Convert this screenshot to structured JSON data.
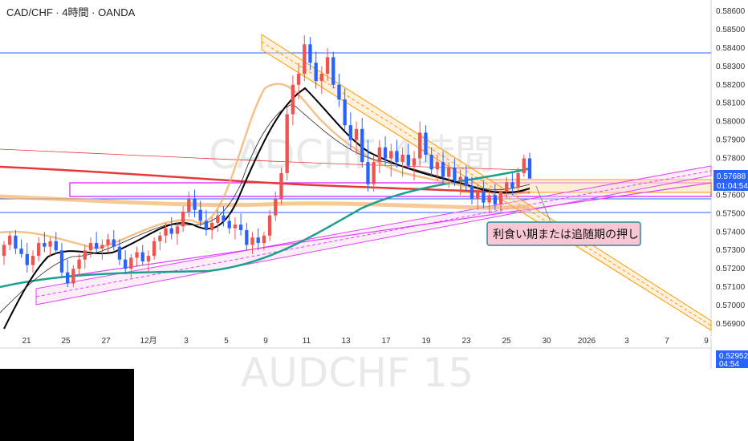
{
  "chart_data": {
    "type": "candlestick",
    "title": "CAD/CHF · 4時間 · OANDA",
    "watermark": "CADCHF 4時間",
    "watermark_bottom": "AUDCHF 15",
    "ylim": [
      0.5685,
      0.5862
    ],
    "y_ticks": [
      "0.58600",
      "0.58500",
      "0.58400",
      "0.58300",
      "0.58200",
      "0.58100",
      "0.58000",
      "0.57900",
      "0.57800",
      "0.57600",
      "0.57500",
      "0.57400",
      "0.57300",
      "0.57200",
      "0.57100",
      "0.57000",
      "0.56900"
    ],
    "x_ticks": [
      "21",
      "25",
      "27",
      "12月",
      "3",
      "5",
      "9",
      "11",
      "13",
      "17",
      "19",
      "23",
      "25",
      "30",
      "2026",
      "3",
      "7",
      "9"
    ],
    "price_label": {
      "value": "0.57688",
      "countdown": "01:04:54",
      "color": "#2962ff"
    },
    "second_price_label": {
      "value": "0.52952",
      "countdown": "04:54",
      "color": "#2962ff"
    },
    "annotation": "利食い期または追随期の押し",
    "colors": {
      "up": "#ef5350",
      "down": "#2962ff",
      "ma_fast": "#000000",
      "ma_teal": "#1e9e8c",
      "ma_red": "#e53935",
      "band_orange": "#f4b26b",
      "channel_orange": "#ff9800",
      "channel_pink": "#e040fb",
      "hline": "#2962ff",
      "annot_bg": "#f8c6d4",
      "annot_border": "#2a8a9a"
    },
    "candles": [
      [
        0.5727,
        0.5735,
        0.5722,
        0.5733
      ],
      [
        0.5733,
        0.574,
        0.573,
        0.5738
      ],
      [
        0.5738,
        0.5741,
        0.5728,
        0.5731
      ],
      [
        0.5731,
        0.5736,
        0.5726,
        0.5728
      ],
      [
        0.5728,
        0.5734,
        0.5718,
        0.5722
      ],
      [
        0.5722,
        0.573,
        0.5718,
        0.5727
      ],
      [
        0.5727,
        0.5737,
        0.5724,
        0.5734
      ],
      [
        0.5734,
        0.574,
        0.5729,
        0.5732
      ],
      [
        0.5732,
        0.5737,
        0.5727,
        0.5735
      ],
      [
        0.5735,
        0.574,
        0.5728,
        0.573
      ],
      [
        0.573,
        0.5734,
        0.5715,
        0.5718
      ],
      [
        0.5718,
        0.5725,
        0.571,
        0.5712
      ],
      [
        0.5712,
        0.5722,
        0.571,
        0.572
      ],
      [
        0.572,
        0.5728,
        0.5716,
        0.5725
      ],
      [
        0.5725,
        0.5733,
        0.572,
        0.573
      ],
      [
        0.573,
        0.5737,
        0.5726,
        0.5734
      ],
      [
        0.5734,
        0.574,
        0.5729,
        0.5731
      ],
      [
        0.5731,
        0.5736,
        0.5725,
        0.5733
      ],
      [
        0.5733,
        0.5739,
        0.5729,
        0.5736
      ],
      [
        0.5736,
        0.5741,
        0.573,
        0.5732
      ],
      [
        0.5732,
        0.5736,
        0.5722,
        0.5725
      ],
      [
        0.5725,
        0.573,
        0.5717,
        0.572
      ],
      [
        0.572,
        0.5728,
        0.5715,
        0.5726
      ],
      [
        0.5726,
        0.5732,
        0.5721,
        0.5729
      ],
      [
        0.5729,
        0.5733,
        0.5722,
        0.5724
      ],
      [
        0.5724,
        0.573,
        0.5718,
        0.5727
      ],
      [
        0.5727,
        0.5737,
        0.5725,
        0.5735
      ],
      [
        0.5735,
        0.574,
        0.573,
        0.5738
      ],
      [
        0.5738,
        0.5745,
        0.5734,
        0.5742
      ],
      [
        0.5742,
        0.5748,
        0.5736,
        0.5739
      ],
      [
        0.5739,
        0.5745,
        0.5733,
        0.5743
      ],
      [
        0.5743,
        0.5754,
        0.574,
        0.5751
      ],
      [
        0.5751,
        0.5762,
        0.5748,
        0.5758
      ],
      [
        0.5758,
        0.5763,
        0.5748,
        0.5752
      ],
      [
        0.5752,
        0.5757,
        0.5743,
        0.5746
      ],
      [
        0.5746,
        0.5752,
        0.5738,
        0.5741
      ],
      [
        0.5741,
        0.5748,
        0.5736,
        0.5745
      ],
      [
        0.5745,
        0.5752,
        0.574,
        0.5749
      ],
      [
        0.5749,
        0.5754,
        0.5743,
        0.5746
      ],
      [
        0.5746,
        0.575,
        0.5739,
        0.5742
      ],
      [
        0.5742,
        0.5748,
        0.5736,
        0.5744
      ],
      [
        0.5744,
        0.575,
        0.5738,
        0.5741
      ],
      [
        0.5741,
        0.5745,
        0.573,
        0.5733
      ],
      [
        0.5733,
        0.574,
        0.5728,
        0.5737
      ],
      [
        0.5737,
        0.5742,
        0.573,
        0.5734
      ],
      [
        0.5734,
        0.574,
        0.573,
        0.5738
      ],
      [
        0.5738,
        0.5752,
        0.5735,
        0.5749
      ],
      [
        0.5749,
        0.5762,
        0.5746,
        0.5758
      ],
      [
        0.5758,
        0.5775,
        0.5755,
        0.5772
      ],
      [
        0.5772,
        0.5808,
        0.5768,
        0.5804
      ],
      [
        0.5804,
        0.5825,
        0.5798,
        0.582
      ],
      [
        0.582,
        0.5832,
        0.5812,
        0.5826
      ],
      [
        0.5826,
        0.5847,
        0.5822,
        0.5842
      ],
      [
        0.5842,
        0.5846,
        0.5828,
        0.5832
      ],
      [
        0.5832,
        0.5838,
        0.5818,
        0.5822
      ],
      [
        0.5822,
        0.583,
        0.5815,
        0.5826
      ],
      [
        0.5826,
        0.584,
        0.5822,
        0.5835
      ],
      [
        0.5835,
        0.5838,
        0.5818,
        0.582
      ],
      [
        0.582,
        0.5826,
        0.5808,
        0.5812
      ],
      [
        0.5812,
        0.5818,
        0.5795,
        0.5798
      ],
      [
        0.5798,
        0.5805,
        0.5785,
        0.579
      ],
      [
        0.579,
        0.58,
        0.5782,
        0.5796
      ],
      [
        0.5796,
        0.5802,
        0.5775,
        0.5778
      ],
      [
        0.5778,
        0.579,
        0.5762,
        0.5766
      ],
      [
        0.5766,
        0.5782,
        0.5762,
        0.5778
      ],
      [
        0.5778,
        0.579,
        0.5772,
        0.5786
      ],
      [
        0.5786,
        0.5792,
        0.5776,
        0.578
      ],
      [
        0.578,
        0.5788,
        0.577,
        0.5784
      ],
      [
        0.5784,
        0.579,
        0.5775,
        0.5778
      ],
      [
        0.5778,
        0.5786,
        0.577,
        0.5782
      ],
      [
        0.5782,
        0.5788,
        0.5774,
        0.5776
      ],
      [
        0.5776,
        0.5784,
        0.5768,
        0.578
      ],
      [
        0.578,
        0.58,
        0.5776,
        0.5794
      ],
      [
        0.5794,
        0.5798,
        0.5778,
        0.5782
      ],
      [
        0.5782,
        0.5786,
        0.577,
        0.5774
      ],
      [
        0.5774,
        0.5782,
        0.5768,
        0.5778
      ],
      [
        0.5778,
        0.5784,
        0.5766,
        0.577
      ],
      [
        0.577,
        0.5778,
        0.5764,
        0.5775
      ],
      [
        0.5775,
        0.578,
        0.5765,
        0.5768
      ],
      [
        0.5768,
        0.5774,
        0.576,
        0.577
      ],
      [
        0.577,
        0.5776,
        0.5762,
        0.5765
      ],
      [
        0.5765,
        0.577,
        0.5755,
        0.5758
      ],
      [
        0.5758,
        0.5766,
        0.5752,
        0.5762
      ],
      [
        0.5762,
        0.5768,
        0.5753,
        0.5756
      ],
      [
        0.5756,
        0.5764,
        0.575,
        0.576
      ],
      [
        0.576,
        0.5766,
        0.5752,
        0.5755
      ],
      [
        0.5755,
        0.5764,
        0.5751,
        0.5762
      ],
      [
        0.5762,
        0.577,
        0.5758,
        0.5767
      ],
      [
        0.5767,
        0.5772,
        0.576,
        0.5764
      ],
      [
        0.5764,
        0.5775,
        0.5762,
        0.5772
      ],
      [
        0.5772,
        0.5782,
        0.577,
        0.578
      ],
      [
        0.578,
        0.5783,
        0.577,
        0.5769
      ]
    ]
  }
}
